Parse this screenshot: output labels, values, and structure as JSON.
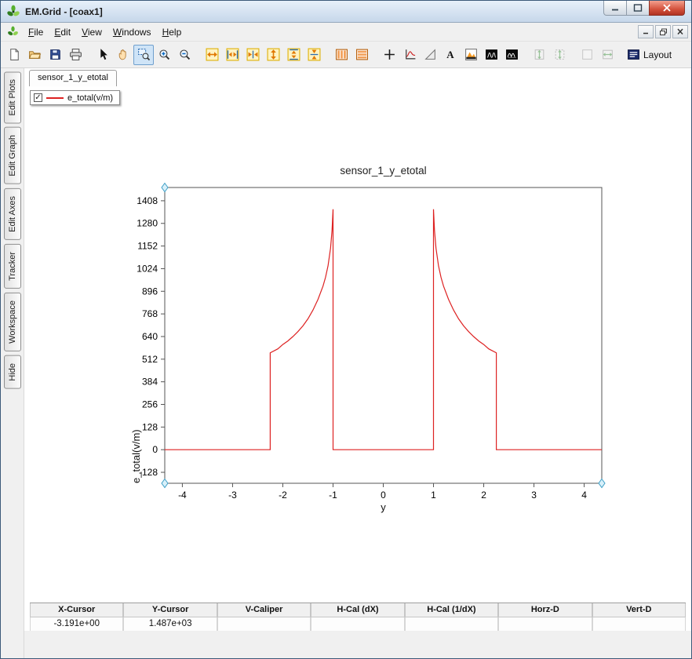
{
  "window": {
    "title": "EM.Grid - [coax1]"
  },
  "menu": {
    "items": [
      "File",
      "Edit",
      "View",
      "Windows",
      "Help"
    ]
  },
  "toolbar": {
    "text_tool_glyph": "A",
    "layout_label": "Layout",
    "icons": [
      "new-file-icon",
      "open-folder-icon",
      "save-icon",
      "print-icon",
      "select-arrow-icon",
      "pan-hand-icon",
      "zoom-window-icon",
      "zoom-in-icon",
      "zoom-out-icon",
      "expand-x-icon",
      "fit-x-icon",
      "shrink-x-icon",
      "expand-y-icon",
      "fit-y-icon",
      "shrink-y-icon",
      "split-columns-icon",
      "split-rows-icon",
      "crosshair-icon",
      "graph-axes-icon",
      "slope-caliper-icon",
      "text-annotation-icon",
      "waterfall-view-icon",
      "spectrogram-dark-icon-1",
      "spectrogram-dark-icon-2",
      "fit-frame-vertical-icon",
      "fit-frame-vertical-alt-icon",
      "empty-frame-icon",
      "fit-frame-horizontal-icon",
      "layout-icon"
    ]
  },
  "sidebar": {
    "tabs": [
      "Edit Plots",
      "Edit Graph",
      "Edit Axes",
      "Tracker",
      "Workspace",
      "Hide"
    ]
  },
  "doc_tab": {
    "label": "sensor_1_y_etotal"
  },
  "legend": {
    "check_glyph": "✓",
    "label": "e_total(v/m)",
    "checked": true,
    "line_color": "#dd2222"
  },
  "chart_data": {
    "type": "line",
    "title": "sensor_1_y_etotal",
    "xlabel": "y",
    "ylabel": "e_total(v/m)",
    "xlim": [
      -4.35,
      4.35
    ],
    "ylim": [
      -190,
      1483
    ],
    "xticks": [
      -4,
      -3,
      -2,
      -1,
      0,
      1,
      2,
      3,
      4
    ],
    "yticks": [
      -128,
      0,
      128,
      256,
      384,
      512,
      640,
      768,
      896,
      1024,
      1152,
      1280,
      1408
    ],
    "grid": false,
    "legend_position": "top-left-floating",
    "series": [
      {
        "name": "e_total(v/m)",
        "color": "#dd2222",
        "points": [
          [
            -4.35,
            0
          ],
          [
            -2.25,
            0
          ],
          [
            -2.25,
            548
          ],
          [
            -2.1,
            570
          ],
          [
            -2.0,
            595
          ],
          [
            -1.9,
            615
          ],
          [
            -1.8,
            640
          ],
          [
            -1.7,
            668
          ],
          [
            -1.6,
            700
          ],
          [
            -1.5,
            740
          ],
          [
            -1.4,
            790
          ],
          [
            -1.3,
            850
          ],
          [
            -1.2,
            925
          ],
          [
            -1.15,
            975
          ],
          [
            -1.1,
            1040
          ],
          [
            -1.05,
            1140
          ],
          [
            -1.02,
            1240
          ],
          [
            -1.0,
            1360
          ],
          [
            -1.0,
            0
          ],
          [
            1.0,
            0
          ],
          [
            1.0,
            1360
          ],
          [
            1.02,
            1240
          ],
          [
            1.05,
            1140
          ],
          [
            1.1,
            1040
          ],
          [
            1.15,
            975
          ],
          [
            1.2,
            925
          ],
          [
            1.3,
            850
          ],
          [
            1.4,
            790
          ],
          [
            1.5,
            740
          ],
          [
            1.6,
            700
          ],
          [
            1.7,
            668
          ],
          [
            1.8,
            640
          ],
          [
            1.9,
            615
          ],
          [
            2.0,
            595
          ],
          [
            2.1,
            570
          ],
          [
            2.25,
            548
          ],
          [
            2.25,
            0
          ],
          [
            4.35,
            0
          ]
        ]
      }
    ]
  },
  "status_table": {
    "headers": [
      "X-Cursor",
      "Y-Cursor",
      "V-Caliper",
      "H-Cal (dX)",
      "H-Cal (1/dX)",
      "Horz-D",
      "Vert-D"
    ],
    "values": [
      "-3.191e+00",
      "1.487e+03",
      "",
      "",
      "",
      "",
      ""
    ]
  }
}
